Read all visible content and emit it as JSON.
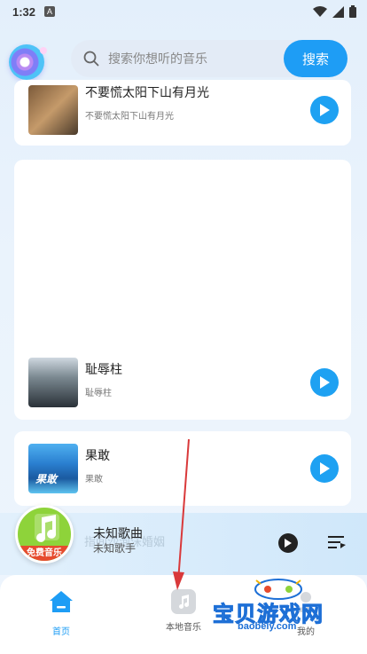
{
  "status_bar": {
    "time": "1:32",
    "badge": "A"
  },
  "search": {
    "placeholder": "搜索你想听的音乐",
    "button_label": "搜索"
  },
  "songs": [
    {
      "title": "不要慌太阳下山有月光",
      "subtitle": "不要慌太阳下山有月光"
    },
    {
      "title": "耻辱柱",
      "subtitle": "耻辱柱"
    },
    {
      "title": "果敢",
      "subtitle": "果敢",
      "cover_text": "果敢"
    }
  ],
  "now_playing": {
    "title": "未知歌曲",
    "artist": "未知歌手",
    "ghost_text": "指间沙泡沫婚姻"
  },
  "free_music": {
    "label": "免费音乐"
  },
  "tabs": [
    {
      "label": "首页",
      "icon": "home-icon",
      "active": true
    },
    {
      "label": "本地音乐",
      "icon": "local-music-icon",
      "active": false
    },
    {
      "label": "我的",
      "icon": "profile-icon",
      "active": false
    }
  ],
  "watermark": {
    "text": "宝贝游戏网",
    "url": "baobeiy.com"
  },
  "colors": {
    "accent": "#1e9df5",
    "free_music_bg": "#8ed33a",
    "free_music_label_bg": "#e64b2e",
    "arrow": "#d9393a"
  }
}
